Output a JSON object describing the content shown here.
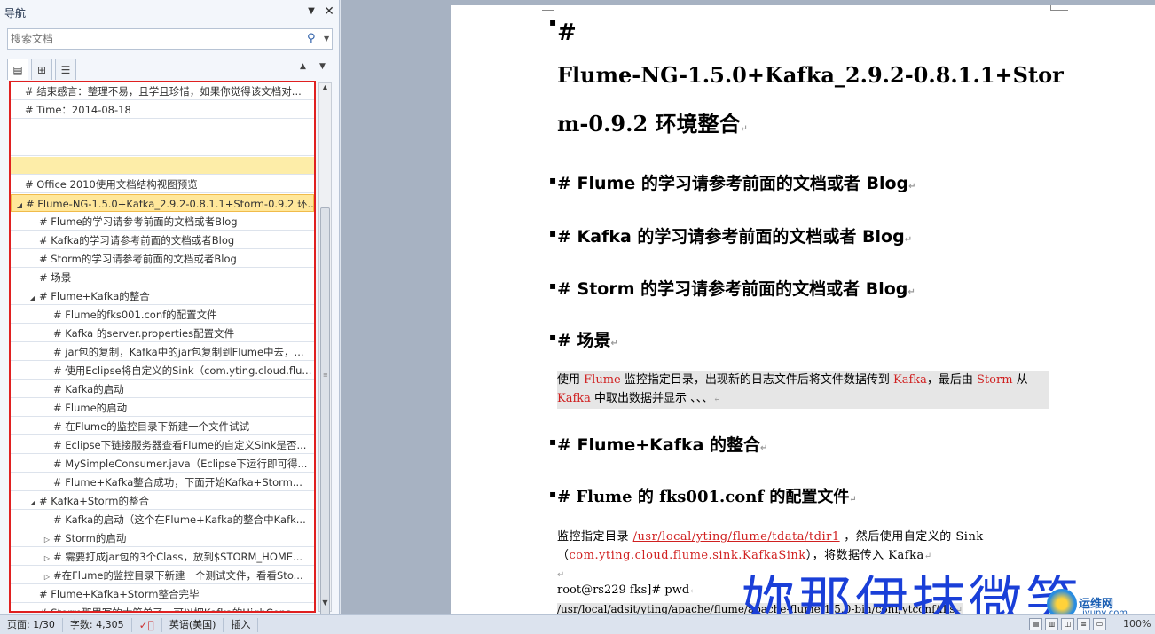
{
  "nav": {
    "title": "导航",
    "dropdown_icon": "chevron-down-icon",
    "close_icon": "close-icon",
    "search_placeholder": "搜索文档",
    "tree": [
      {
        "text": "# 结束感言：整理不易，且学且珍惜，如果你觉得该文档对...",
        "level": 0,
        "toggle": ""
      },
      {
        "text": "# Time：2014-08-18",
        "level": 0,
        "toggle": ""
      },
      {
        "text": "",
        "level": 0,
        "toggle": ""
      },
      {
        "text": "",
        "level": 0,
        "toggle": ""
      },
      {
        "text": "",
        "level": 0,
        "toggle": "",
        "state": "hl"
      },
      {
        "text": "# Office 2010使用文档结构视图预览",
        "level": 0,
        "toggle": ""
      },
      {
        "text": "# Flume-NG-1.5.0+Kafka_2.9.2-0.8.1.1+Storm-0.9.2 环...",
        "level": 0,
        "toggle": "◢",
        "state": "selected"
      },
      {
        "text": "# Flume的学习请参考前面的文档或者Blog",
        "level": 1,
        "toggle": ""
      },
      {
        "text": "# Kafka的学习请参考前面的文档或者Blog",
        "level": 1,
        "toggle": ""
      },
      {
        "text": "# Storm的学习请参考前面的文档或者Blog",
        "level": 1,
        "toggle": ""
      },
      {
        "text": "# 场景",
        "level": 1,
        "toggle": ""
      },
      {
        "text": "# Flume+Kafka的整合",
        "level": 1,
        "toggle": "◢"
      },
      {
        "text": "# Flume的fks001.conf的配置文件",
        "level": 2,
        "toggle": ""
      },
      {
        "text": "# Kafka 的server.properties配置文件",
        "level": 2,
        "toggle": ""
      },
      {
        "text": "# jar包的复制，Kafka中的jar包复制到Flume中去，...",
        "level": 2,
        "toggle": ""
      },
      {
        "text": "# 使用Eclipse将自定义的Sink（com.yting.cloud.flu...",
        "level": 2,
        "toggle": ""
      },
      {
        "text": "# Kafka的启动",
        "level": 2,
        "toggle": ""
      },
      {
        "text": "# Flume的启动",
        "level": 2,
        "toggle": ""
      },
      {
        "text": "# 在Flume的监控目录下新建一个文件试试",
        "level": 2,
        "toggle": ""
      },
      {
        "text": "# Eclipse下链接服务器查看Flume的自定义Sink是否...",
        "level": 2,
        "toggle": ""
      },
      {
        "text": "# MySimpleConsumer.java（Eclipse下运行即可得...",
        "level": 2,
        "toggle": ""
      },
      {
        "text": "# Flume+Kafka整合成功，下面开始Kafka+Storm...",
        "level": 2,
        "toggle": ""
      },
      {
        "text": "# Kafka+Storm的整合",
        "level": 1,
        "toggle": "◢"
      },
      {
        "text": "# Kafka的启动（这个在Flume+Kafka的整合中Kafk...",
        "level": 2,
        "toggle": ""
      },
      {
        "text": "# Storm的启动",
        "level": 2,
        "toggle": "▷"
      },
      {
        "text": "# 需要打成jar包的3个Class，放到$STORM_HOME...",
        "level": 2,
        "toggle": "▷"
      },
      {
        "text": "#在Flume的监控目录下新建一个测试文件，看看Sto...",
        "level": 2,
        "toggle": "▷"
      },
      {
        "text": "# Flume+Kafka+Storm整合完毕",
        "level": 1,
        "toggle": ""
      },
      {
        "text": "# Storm那里写的太简单了，可以把Kafka的HighCons...",
        "level": 1,
        "toggle": ""
      }
    ]
  },
  "document": {
    "title_line1": "#",
    "title_line2": "Flume-NG-1.5.0+Kafka_2.9.2-0.8.1.1+Stor",
    "title_line3": "m-0.9.2  环境整合",
    "h_flume": "# Flume 的学习请参考前面的文档或者 Blog",
    "h_kafka": "# Kafka 的学习请参考前面的文档或者 Blog",
    "h_storm": "# Storm 的学习请参考前面的文档或者 Blog",
    "h_scene": "#  场景",
    "scene": {
      "p1": "使用 ",
      "flume": "Flume",
      "p2": " 监控指定目录，出现新的日志文件后将文件数据传到 ",
      "kafka": "Kafka",
      "p3": "，最后由 ",
      "storm": "Storm",
      "p4": " 从",
      "kafka2": "Kafka",
      "p5": " 中取出数据并显示 、、、"
    },
    "h_flume_kafka": "# Flume+Kafka 的整合",
    "h_fks": "# Flume 的 fks001.conf 的配置文件",
    "conf": {
      "p1": "监控指定目录 ",
      "path": "/usr/local/yting/flume/tdata/tdir1",
      "p2": " ，然后使用自定义的 Sink（",
      "sink": "com.yting.cloud.flume.sink.KafkaSink",
      "p3": "），将数据传入 Kafka"
    },
    "cmd": "root@rs229 fks]# pwd",
    "path_line": "/usr/local/adsit/yting/apache/flume/apache-flume-1.5.0-bin/conf/ytconf/fks"
  },
  "watermark": {
    "text": "妳那伊抹微笑",
    "logo_text": "运维网",
    "logo_sub": "iyunv.com"
  },
  "status": {
    "page": "页面: 1/30",
    "words": "字数: 4,305",
    "spell_icon": "spell-check-icon",
    "language": "英语(美国)",
    "insert": "插入",
    "zoom": "100%"
  }
}
